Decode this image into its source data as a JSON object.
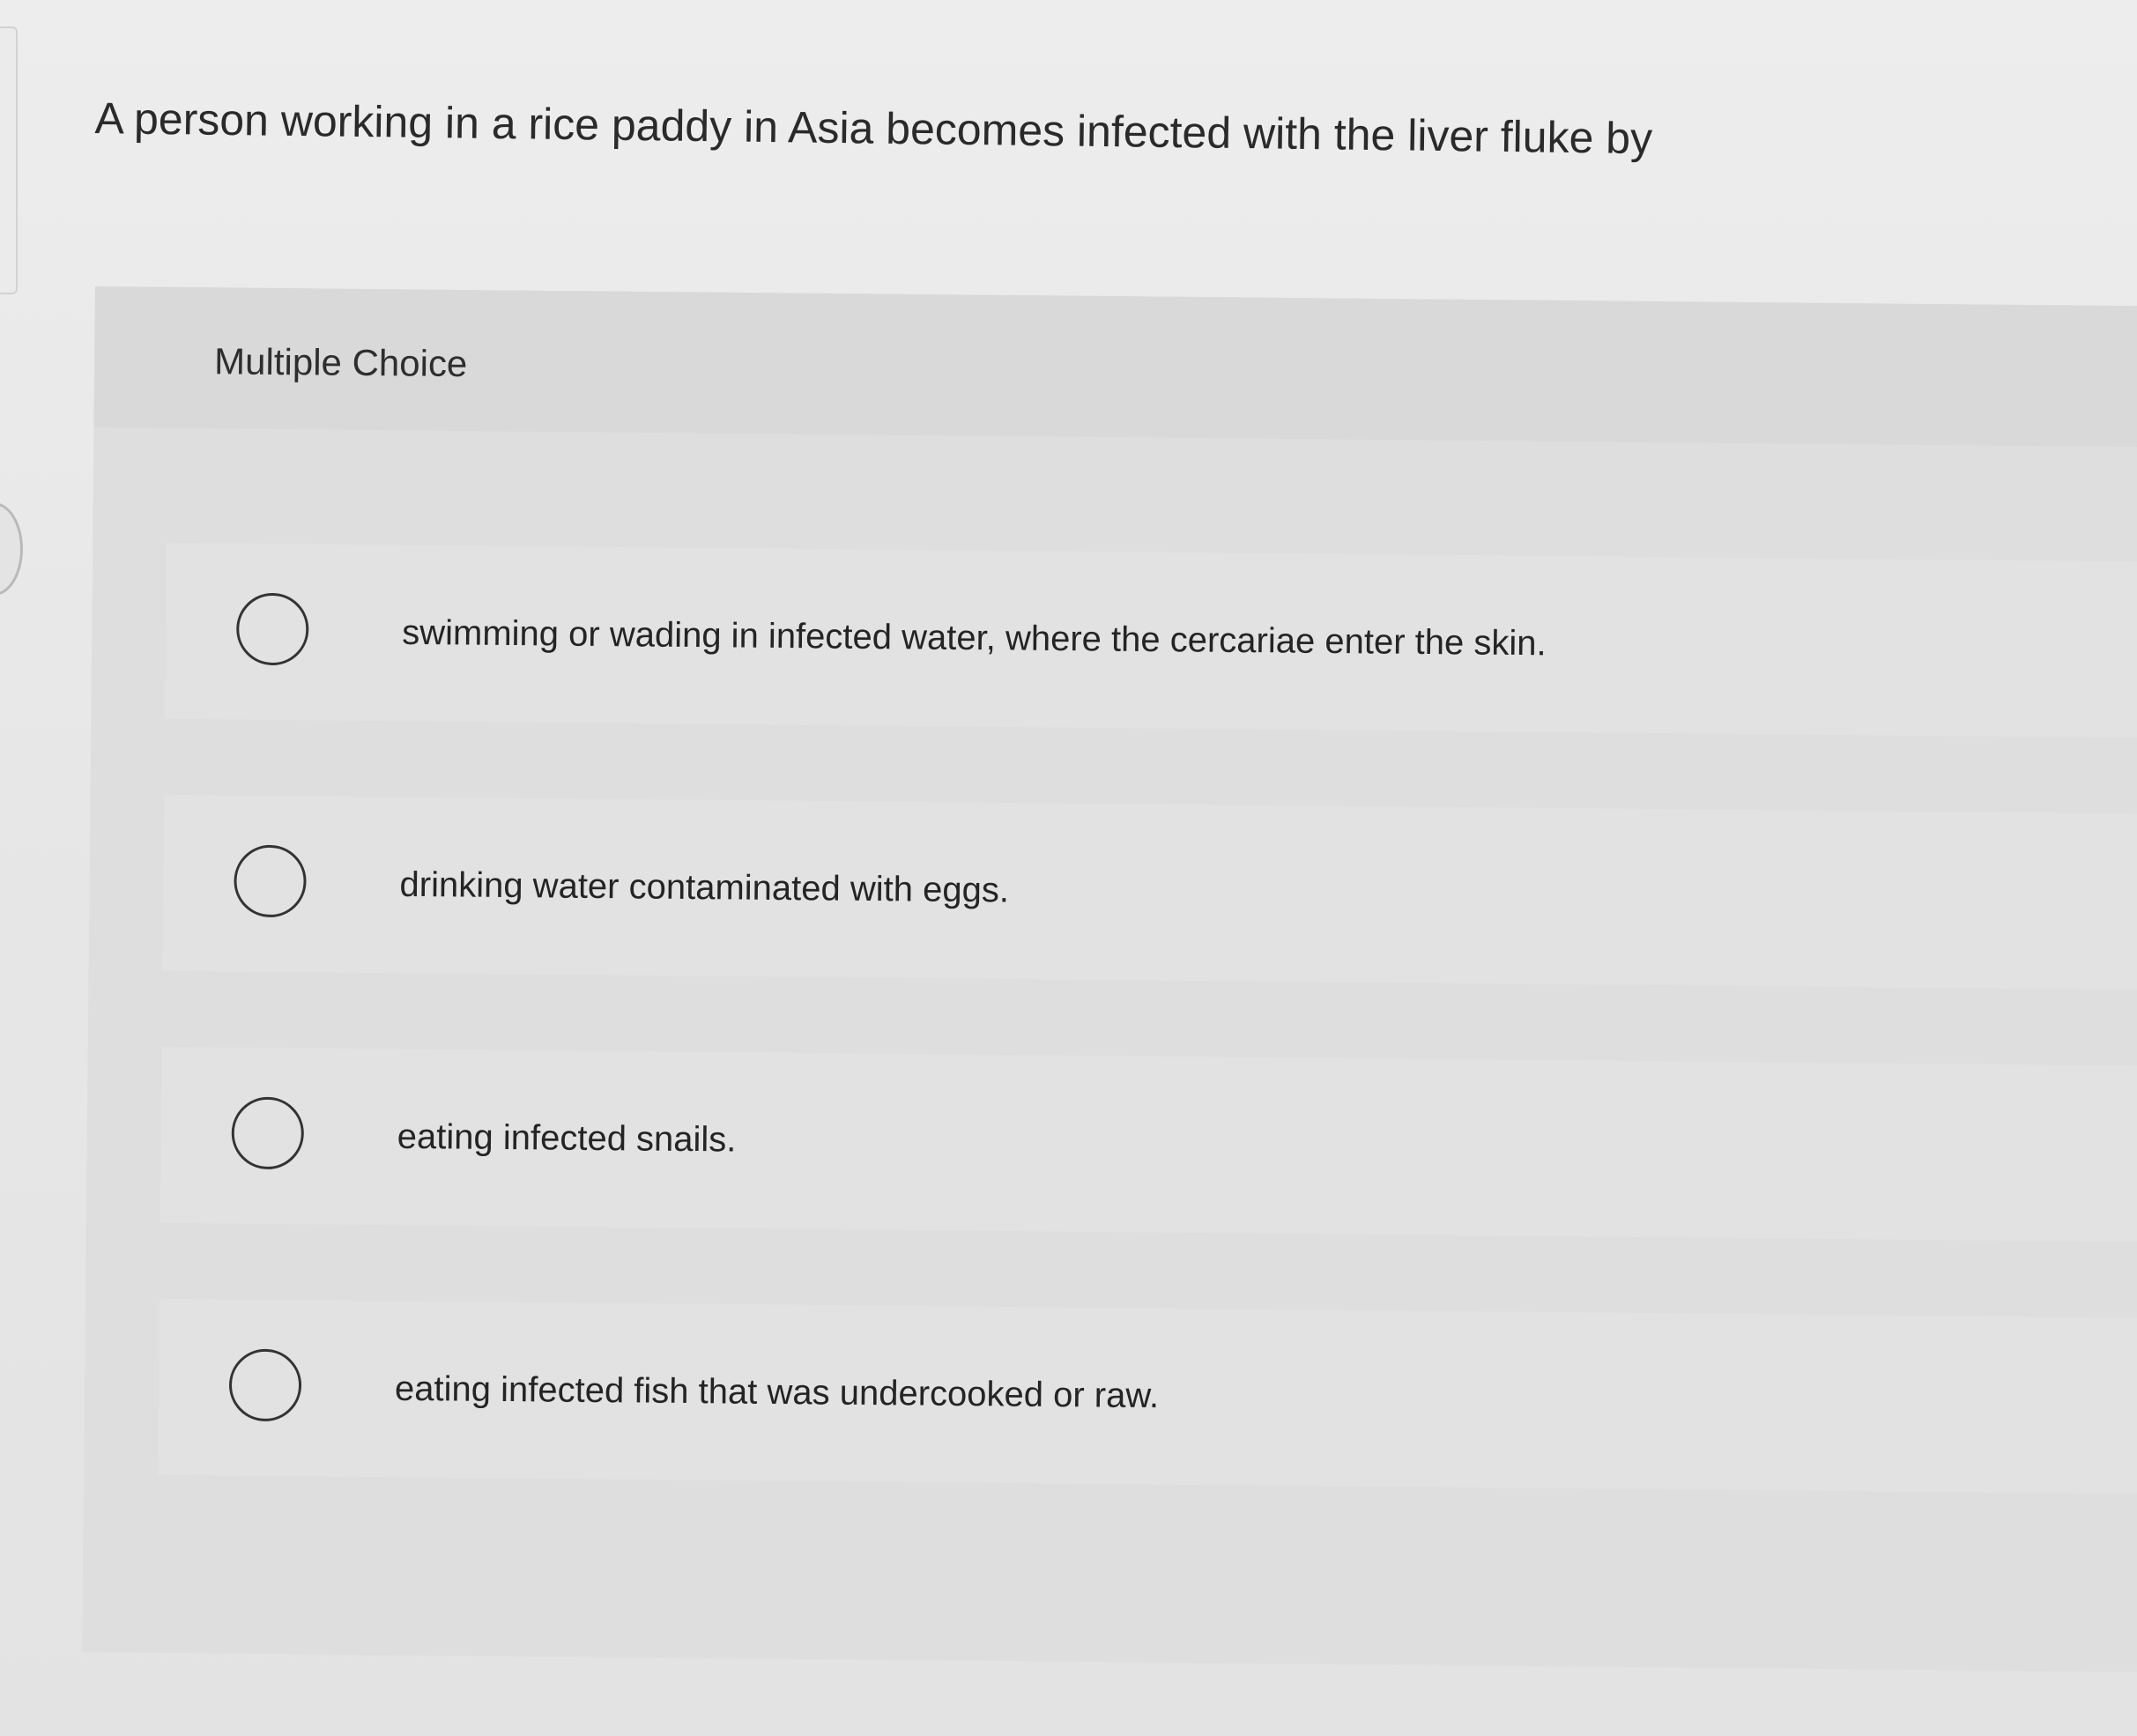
{
  "question": {
    "text": "A person working in a rice paddy in Asia becomes infected with the liver fluke by"
  },
  "section": {
    "label": "Multiple Choice"
  },
  "options": [
    {
      "label": "swimming or wading in infected water, where the cercariae enter the skin.",
      "selected": false
    },
    {
      "label": "drinking water contaminated with eggs.",
      "selected": false
    },
    {
      "label": "eating infected snails.",
      "selected": false
    },
    {
      "label": "eating infected fish that was undercooked or raw.",
      "selected": false
    }
  ],
  "colors": {
    "background": "#e6e6e6",
    "option_background": "#e2e2e2",
    "radio_border": "#333333",
    "text": "#2b2b2b"
  }
}
